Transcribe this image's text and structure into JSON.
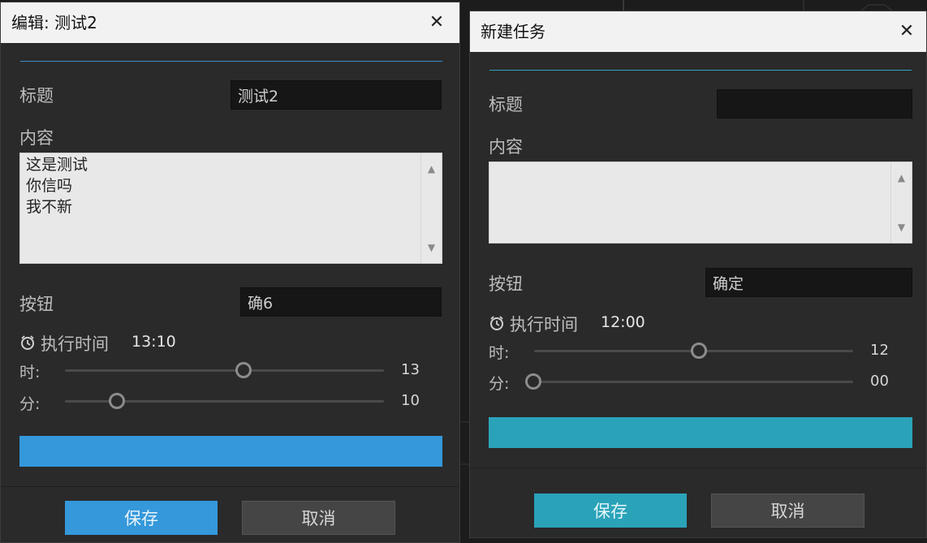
{
  "colors": {
    "accent_blue": "#3498db",
    "accent_teal": "#2aa3b9",
    "dialog_bg": "#2a2a2a",
    "titlebar_bg": "#f2f2f2"
  },
  "edit_dialog": {
    "title": "编辑: 测试2",
    "close_icon": "close-icon",
    "title_label": "标题",
    "title_value": "测试2",
    "content_label": "内容",
    "content_lines": [
      "这是测试",
      "你信吗",
      "我不新"
    ],
    "button_label": "按钮",
    "button_value": "确6",
    "time_label": "执行时间",
    "time_value": "13:10",
    "hour_label": "时:",
    "hour_value": "13",
    "hour_fraction": 0.565,
    "minute_label": "分:",
    "minute_value": "10",
    "minute_fraction": 0.169,
    "save_label": "保存",
    "cancel_label": "取消"
  },
  "new_dialog": {
    "title": "新建任务",
    "close_icon": "close-icon",
    "title_label": "标题",
    "title_value": "",
    "content_label": "内容",
    "content_lines": [],
    "button_label": "按钮",
    "button_value": "确定",
    "time_label": "执行时间",
    "time_value": "12:00",
    "hour_label": "时:",
    "hour_value": "12",
    "hour_fraction": 0.522,
    "minute_label": "分:",
    "minute_value": "00",
    "minute_fraction": 0.0,
    "save_label": "保存",
    "cancel_label": "取消"
  }
}
